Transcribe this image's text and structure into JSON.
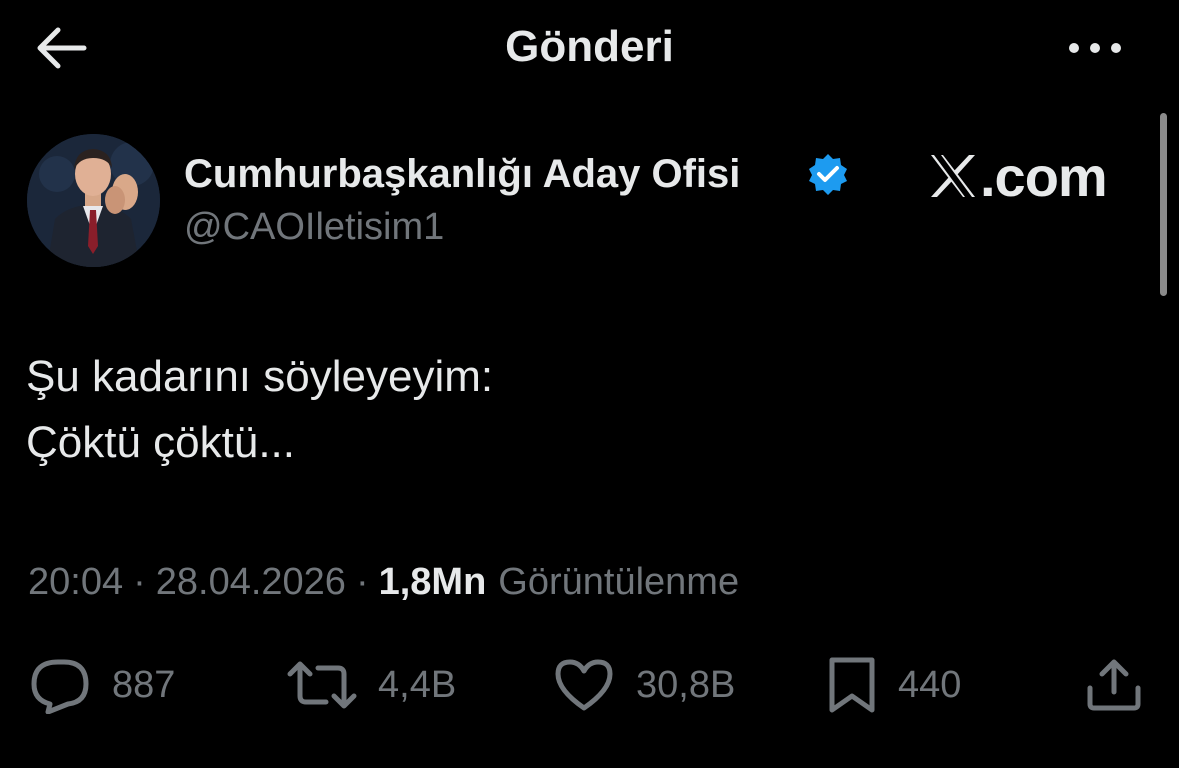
{
  "header": {
    "title": "Gönderi",
    "back_icon": "arrow-left-icon",
    "more_icon": "more-horizontal-icon"
  },
  "author": {
    "display_name": "Cumhurbaşkanlığı Aday Ofisi",
    "handle": "@CAOIletisim1",
    "verified": true,
    "verified_color": "#1d9bf0"
  },
  "watermark": {
    "text": ".com"
  },
  "tweet": {
    "lines": [
      "Şu kadarını söyleyeyim:",
      "Çöktü çöktü..."
    ]
  },
  "meta": {
    "time": "20:04",
    "date": "28.04.2026",
    "views_count": "1,8Mn",
    "views_label": "Görüntülenme",
    "separator": "·"
  },
  "actions": {
    "replies": "887",
    "reposts": "4,4B",
    "likes": "30,8B",
    "bookmarks": "440"
  },
  "colors": {
    "background": "#000000",
    "primary_text": "#e7e9ea",
    "secondary_text": "#71767b",
    "accent": "#1d9bf0"
  }
}
